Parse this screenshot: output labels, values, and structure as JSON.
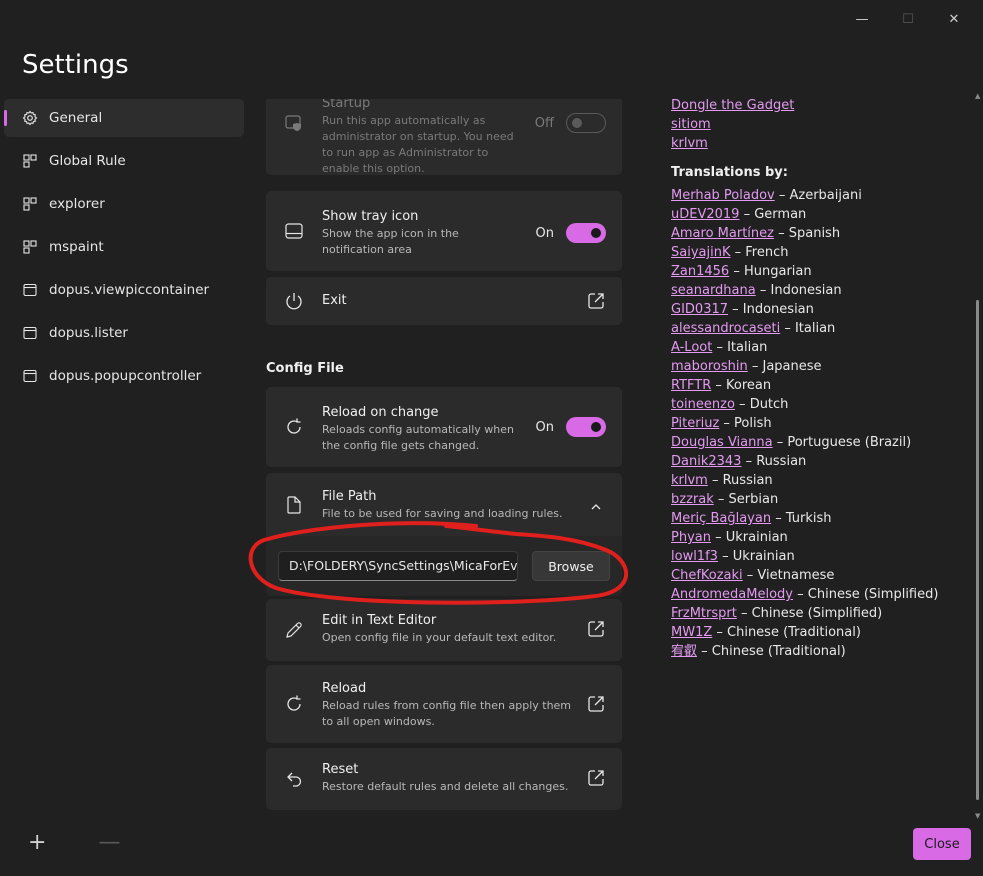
{
  "window": {
    "title": "Settings"
  },
  "titlebar": {
    "minimize": "—",
    "maximize": "☐",
    "close": "✕"
  },
  "nav": {
    "items": [
      {
        "label": "General",
        "icon": "gear-icon",
        "selected": true
      },
      {
        "label": "Global Rule",
        "icon": "window-icon"
      },
      {
        "label": "explorer",
        "icon": "window-icon"
      },
      {
        "label": "mspaint",
        "icon": "window-icon"
      },
      {
        "label": "dopus.viewpiccontainer",
        "icon": "window-icon"
      },
      {
        "label": "dopus.lister",
        "icon": "window-icon"
      },
      {
        "label": "dopus.popupcontroller",
        "icon": "window-icon"
      }
    ],
    "add_label": "+",
    "remove_label": "—"
  },
  "general": {
    "run_admin": {
      "title": "Run as Administrator on Startup",
      "subtitle": "Run this app automatically as administrator on startup. You need to run app as Administrator to enable this option.",
      "state": "Off"
    },
    "tray_icon": {
      "title": "Show tray icon",
      "subtitle": "Show the app icon in the notification area",
      "state": "On"
    },
    "exit": {
      "title": "Exit"
    },
    "config_section": "Config File",
    "reload_on_change": {
      "title": "Reload on change",
      "subtitle": "Reloads config automatically when the config file gets changed.",
      "state": "On"
    },
    "file_path": {
      "title": "File Path",
      "subtitle": "File to be used for saving and loading rules.",
      "value": "D:\\FOLDERY\\SyncSettings\\MicaForEveryone",
      "browse": "Browse"
    },
    "edit_text": {
      "title": "Edit in Text Editor",
      "subtitle": "Open config file in your default text editor."
    },
    "reload": {
      "title": "Reload",
      "subtitle": "Reload rules from config file then apply them to all open windows."
    },
    "reset": {
      "title": "Reset",
      "subtitle": "Restore default rules and delete all changes."
    }
  },
  "credits": {
    "contributors": [
      "Dongle the Gadget",
      "sitiom",
      "krlvm"
    ],
    "translations_heading": "Translations by:",
    "translations": [
      {
        "name": "Merhab Poladov",
        "lang": "Azerbaijani"
      },
      {
        "name": "uDEV2019",
        "lang": "German"
      },
      {
        "name": "Amaro Martínez",
        "lang": "Spanish"
      },
      {
        "name": "SaiyajinK",
        "lang": "French"
      },
      {
        "name": "Zan1456",
        "lang": "Hungarian"
      },
      {
        "name": "seanardhana",
        "lang": "Indonesian"
      },
      {
        "name": "GID0317",
        "lang": "Indonesian"
      },
      {
        "name": "alessandrocaseti",
        "lang": "Italian"
      },
      {
        "name": "A-Loot",
        "lang": "Italian"
      },
      {
        "name": "maboroshin",
        "lang": "Japanese"
      },
      {
        "name": "RTFTR",
        "lang": "Korean"
      },
      {
        "name": "toineenzo",
        "lang": "Dutch"
      },
      {
        "name": "Piteriuz",
        "lang": "Polish"
      },
      {
        "name": "Douglas Vianna",
        "lang": "Portuguese (Brazil)"
      },
      {
        "name": "Danik2343",
        "lang": "Russian"
      },
      {
        "name": "krlvm",
        "lang": "Russian"
      },
      {
        "name": "bzzrak",
        "lang": "Serbian"
      },
      {
        "name": "Meriç Bağlayan",
        "lang": "Turkish"
      },
      {
        "name": "Phyan",
        "lang": "Ukrainian"
      },
      {
        "name": "lowl1f3",
        "lang": "Ukrainian"
      },
      {
        "name": "ChefKozaki",
        "lang": "Vietnamese"
      },
      {
        "name": "AndromedaMelody",
        "lang": "Chinese (Simplified)"
      },
      {
        "name": "FrzMtrsprt",
        "lang": "Chinese (Simplified)"
      },
      {
        "name": "MW1Z",
        "lang": "Chinese (Traditional)"
      },
      {
        "name": "宥叡",
        "lang": "Chinese (Traditional)"
      }
    ],
    "separator": " – "
  },
  "footer": {
    "close_label": "Close"
  },
  "colors": {
    "accent": "#d86ae6",
    "background": "#202020",
    "card": "#2b2b2b",
    "annotation": "#e0201c"
  }
}
